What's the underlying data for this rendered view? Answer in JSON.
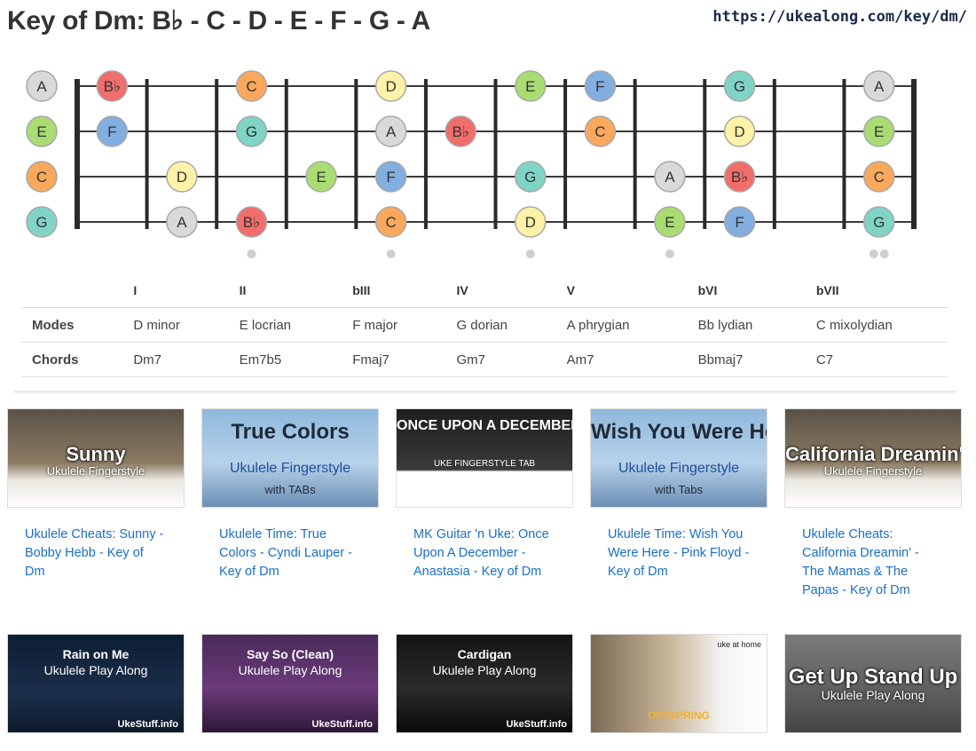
{
  "header": {
    "title": "Key of Dm: B♭ - C - D - E - F - G - A",
    "url": "https://ukealong.com/key/dm/"
  },
  "colors": {
    "A": "#d9d9d9",
    "Bb": "#f06e6c",
    "C": "#f9a85c",
    "D": "#fdf2a8",
    "E": "#a9dc72",
    "F": "#82aee0",
    "G": "#80d4c6"
  },
  "fretboard": {
    "open_strings": [
      "A",
      "E",
      "C",
      "G"
    ],
    "frets": 12,
    "markers": [
      {
        "fret": 3,
        "count": 1
      },
      {
        "fret": 5,
        "count": 1
      },
      {
        "fret": 7,
        "count": 1
      },
      {
        "fret": 9,
        "count": 1
      },
      {
        "fret": 12,
        "count": 2
      }
    ],
    "notes": [
      {
        "string": 0,
        "fret": 1,
        "note": "Bb",
        "label": "B♭"
      },
      {
        "string": 0,
        "fret": 3,
        "note": "C",
        "label": "C"
      },
      {
        "string": 0,
        "fret": 5,
        "note": "D",
        "label": "D"
      },
      {
        "string": 0,
        "fret": 7,
        "note": "E",
        "label": "E"
      },
      {
        "string": 0,
        "fret": 8,
        "note": "F",
        "label": "F"
      },
      {
        "string": 0,
        "fret": 10,
        "note": "G",
        "label": "G"
      },
      {
        "string": 0,
        "fret": 12,
        "note": "A",
        "label": "A"
      },
      {
        "string": 1,
        "fret": 1,
        "note": "F",
        "label": "F"
      },
      {
        "string": 1,
        "fret": 3,
        "note": "G",
        "label": "G"
      },
      {
        "string": 1,
        "fret": 5,
        "note": "A",
        "label": "A"
      },
      {
        "string": 1,
        "fret": 6,
        "note": "Bb",
        "label": "B♭"
      },
      {
        "string": 1,
        "fret": 8,
        "note": "C",
        "label": "C"
      },
      {
        "string": 1,
        "fret": 10,
        "note": "D",
        "label": "D"
      },
      {
        "string": 1,
        "fret": 12,
        "note": "E",
        "label": "E"
      },
      {
        "string": 2,
        "fret": 2,
        "note": "D",
        "label": "D"
      },
      {
        "string": 2,
        "fret": 4,
        "note": "E",
        "label": "E"
      },
      {
        "string": 2,
        "fret": 5,
        "note": "F",
        "label": "F"
      },
      {
        "string": 2,
        "fret": 7,
        "note": "G",
        "label": "G"
      },
      {
        "string": 2,
        "fret": 9,
        "note": "A",
        "label": "A"
      },
      {
        "string": 2,
        "fret": 10,
        "note": "Bb",
        "label": "B♭"
      },
      {
        "string": 2,
        "fret": 12,
        "note": "C",
        "label": "C"
      },
      {
        "string": 3,
        "fret": 2,
        "note": "A",
        "label": "A"
      },
      {
        "string": 3,
        "fret": 3,
        "note": "Bb",
        "label": "B♭"
      },
      {
        "string": 3,
        "fret": 5,
        "note": "C",
        "label": "C"
      },
      {
        "string": 3,
        "fret": 7,
        "note": "D",
        "label": "D"
      },
      {
        "string": 3,
        "fret": 9,
        "note": "E",
        "label": "E"
      },
      {
        "string": 3,
        "fret": 10,
        "note": "F",
        "label": "F"
      },
      {
        "string": 3,
        "fret": 12,
        "note": "G",
        "label": "G"
      }
    ]
  },
  "scale_table": {
    "degrees": [
      "I",
      "II",
      "bIII",
      "IV",
      "V",
      "bVI",
      "bVII"
    ],
    "modes_label": "Modes",
    "modes": [
      "D minor",
      "E locrian",
      "F major",
      "G dorian",
      "A phrygian",
      "Bb lydian",
      "C mixolydian"
    ],
    "chords_label": "Chords",
    "chords": [
      "Dm7",
      "Em7b5",
      "Fmaj7",
      "Gm7",
      "Am7",
      "Bbmaj7",
      "C7"
    ]
  },
  "videos": [
    {
      "title": "Ukulele Cheats: Sunny - Bobby Hebb - Key of Dm",
      "thumb_line1": "Sunny",
      "thumb_line2": "Ukulele Fingerstyle",
      "thumb_footer": "",
      "theme": "sunny"
    },
    {
      "title": "Ukulele Time: True Colors - Cyndi Lauper - Key of Dm",
      "thumb_line1": "True Colors",
      "thumb_line2": "Ukulele Fingerstyle",
      "thumb_footer": "with TABs",
      "theme": "sky"
    },
    {
      "title": "MK Guitar 'n Uke: Once Upon A December - Anastasia - Key of Dm",
      "thumb_line1": "ONCE UPON A DECEMBER",
      "thumb_line2": "UKE FINGERSTYLE TAB",
      "thumb_footer": "",
      "theme": "dark-tab"
    },
    {
      "title": "Ukulele Time: Wish You Were Here - Pink Floyd - Key of Dm",
      "thumb_line1": "Wish You Were Here",
      "thumb_line2": "Ukulele Fingerstyle",
      "thumb_footer": "with Tabs",
      "theme": "sky"
    },
    {
      "title": "Ukulele Cheats: California Dreamin' - The Mamas & The Papas - Key of Dm",
      "thumb_line1": "California Dreamin'",
      "thumb_line2": "Ukulele Fingerstyle",
      "thumb_footer": "",
      "theme": "sunny"
    },
    {
      "title": "",
      "thumb_line1": "Rain on Me",
      "thumb_line2": "Ukulele Play Along",
      "thumb_footer": "UkeStuff.info",
      "theme": "dark-blue"
    },
    {
      "title": "",
      "thumb_line1": "Say So (Clean)",
      "thumb_line2": "Ukulele Play Along",
      "thumb_footer": "UkeStuff.info",
      "theme": "purple"
    },
    {
      "title": "",
      "thumb_line1": "Cardigan",
      "thumb_line2": "Ukulele Play Along",
      "thumb_footer": "UkeStuff.info",
      "theme": "dark-keys"
    },
    {
      "title": "",
      "thumb_line1": "OFFSPRING",
      "thumb_line2": "",
      "thumb_footer": "uke at home",
      "theme": "person"
    },
    {
      "title": "",
      "thumb_line1": "Get Up Stand Up",
      "thumb_line2": "Ukulele Play Along",
      "thumb_footer": "",
      "theme": "gray"
    }
  ]
}
